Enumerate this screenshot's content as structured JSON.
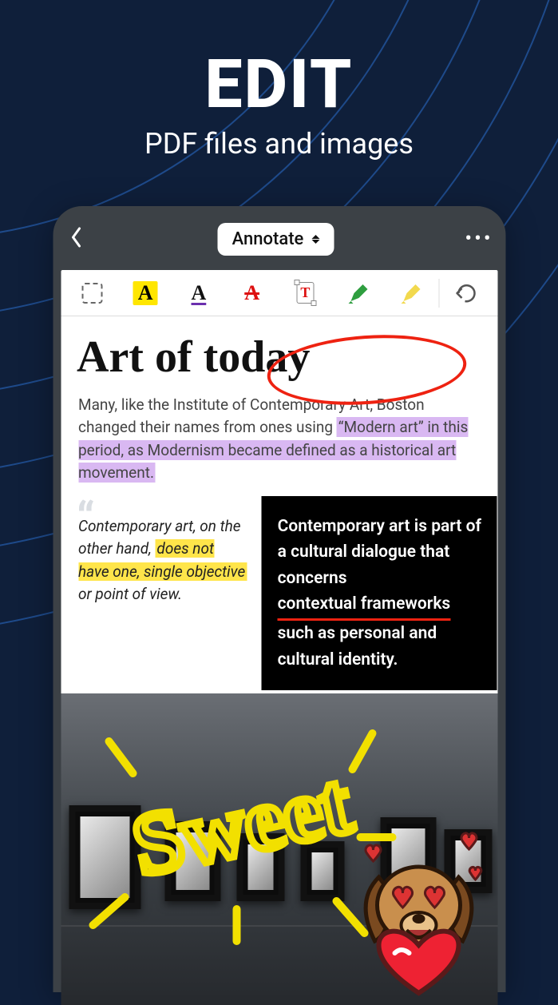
{
  "hero": {
    "title": "EDIT",
    "subtitle": "PDF files and images"
  },
  "topbar": {
    "mode_label": "Annotate"
  },
  "tools": {
    "select": "select-area",
    "highlight": "A",
    "underline": "A",
    "strike": "A",
    "textbox": "T",
    "pen": "highlighter-green",
    "eraser": "highlighter-yellow",
    "undo": "undo"
  },
  "document": {
    "heading": "Art of today",
    "para_pre": "Many, like the Institute of Contemporary Art, Boston changed their names from ones using ",
    "para_hl": "“Modern art” in this period, as Modernism became defined as a historical art movement.",
    "quote_pre": "Contemporary art, on the other hand, ",
    "quote_hl": "does not have one, single objective",
    "quote_post": " or point of view.",
    "dark_pre": "Contemporary art is part of a cultural dialogue that concerns ",
    "dark_underlined": "contextual frameworks",
    "dark_post": " such as personal and cultural identity.",
    "handwriting": "Sweet"
  },
  "colors": {
    "bg": "#0f1f3a",
    "arc": "#1e4a8a",
    "yellow": "#ffe600",
    "purple_hl": "#d9b8f2",
    "red": "#e21b1b",
    "green": "#2e9e3f"
  }
}
